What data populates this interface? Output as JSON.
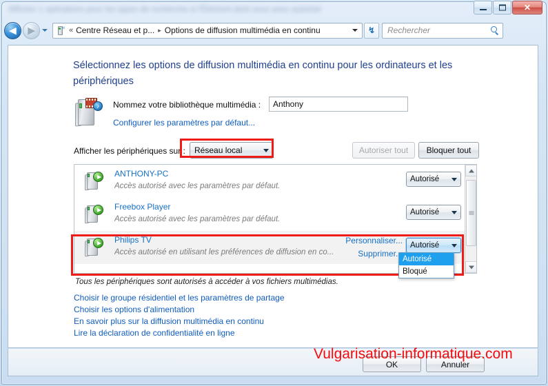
{
  "window": {
    "blurred_title": "Afficher 1 opérations pour les types de recherche à l'Élément dont vous avez autorisé",
    "controls": {
      "minimize": "minimize-icon",
      "maximize": "maximize-icon",
      "close": "✕"
    }
  },
  "navbar": {
    "back_arrow": "◀",
    "forward_arrow": "▶",
    "address_icon": "network-device-icon",
    "chevrons": "«",
    "crumb1": "Centre Réseau et p...",
    "crumb_sep": "▸",
    "crumb2": "Options de diffusion multimédia en continu",
    "refresh_glyph": "↯",
    "search_placeholder": "Rechercher"
  },
  "content": {
    "heading": "Sélectionnez les options de diffusion multimédia en continu pour les ordinateurs et les périphériques",
    "library": {
      "label": "Nommez votre bibliothèque multimédia :",
      "value": "Anthony",
      "link": "Configurer les paramètres par défaut..."
    },
    "filter": {
      "label": "Afficher les périphériques sur :",
      "selected": "Réseau local",
      "allow_all": "Autoriser tout",
      "block_all": "Bloquer tout"
    },
    "devices": [
      {
        "name": "ANTHONY-PC",
        "description": "Accès autorisé avec les paramètres par défaut.",
        "state": "Autorisé"
      },
      {
        "name": "Freebox Player",
        "description": "Accès autorisé avec les paramètres par défaut.",
        "state": "Autorisé"
      },
      {
        "name": "Philips TV",
        "description": "Accès autorisé en utilisant les préférences de diffusion en co...",
        "state": "Autorisé",
        "customize_link": "Personnaliser...",
        "remove_link": "Supprimer..."
      }
    ],
    "dropdown_options": [
      {
        "label": "Autorisé",
        "selected": true
      },
      {
        "label": "Bloqué",
        "selected": false
      }
    ],
    "status": "Tous les périphériques sont autorisés à accéder à vos fichiers multimédias.",
    "footer_links": [
      "Choisir le groupe résidentiel et les paramètres de partage",
      "Choisir les options d'alimentation",
      "En savoir plus sur la diffusion multimédia en continu",
      "Lire la déclaration de confidentialité en ligne"
    ]
  },
  "footer": {
    "ok": "OK",
    "cancel": "Annuler"
  },
  "watermark": "Vulgarisation-informatique.com",
  "colors": {
    "accent_link": "#0f5cc0",
    "heading": "#1f3f8f",
    "annotation_red": "#ee1b16",
    "watermark_red": "#f30c0c",
    "selection_blue": "#1fa0ef"
  }
}
